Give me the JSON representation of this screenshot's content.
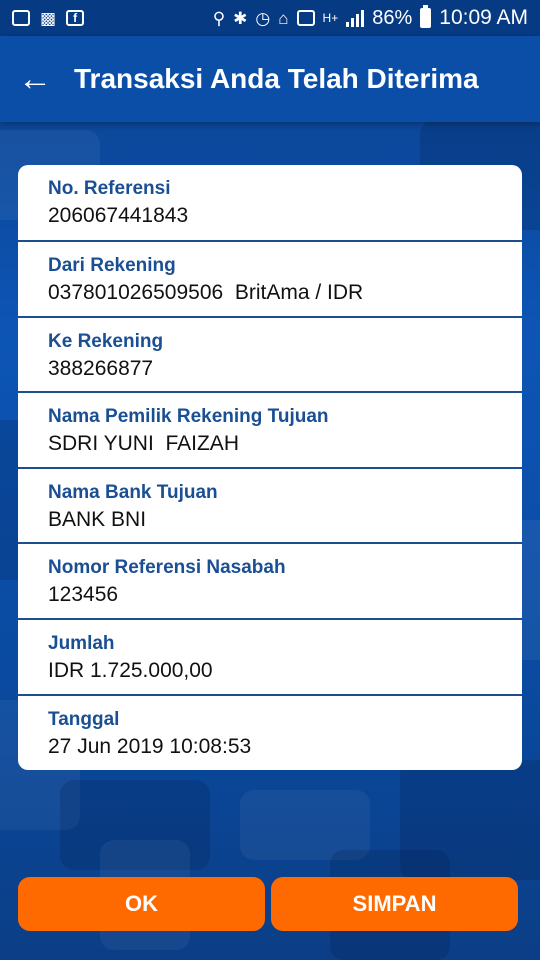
{
  "status_bar": {
    "battery": "86%",
    "time": "10:09 AM",
    "left_icons": [
      "mail-icon",
      "car-icon",
      "facebook-icon"
    ],
    "right_icons": [
      "location-icon",
      "bluetooth-icon",
      "alarm-icon",
      "home-icon",
      "signal-icon",
      "network-icon",
      "signal-bars-icon",
      "battery-icon"
    ]
  },
  "header": {
    "title": "Transaksi Anda Telah Diterima",
    "back_icon": "arrow-left-icon"
  },
  "details": [
    {
      "label": "No. Referensi",
      "value": "206067441843"
    },
    {
      "label": "Dari Rekening",
      "value": "037801026509506  BritAma / IDR"
    },
    {
      "label": "Ke Rekening",
      "value": "388266877"
    },
    {
      "label": "Nama Pemilik Rekening Tujuan",
      "value": "SDRI YUNI  FAIZAH"
    },
    {
      "label": "Nama Bank Tujuan",
      "value": "BANK BNI"
    },
    {
      "label": "Nomor Referensi Nasabah",
      "value": "123456"
    },
    {
      "label": "Jumlah",
      "value": "IDR 1.725.000,00"
    },
    {
      "label": "Tanggal",
      "value": "27 Jun 2019 10:08:53"
    }
  ],
  "actions": {
    "ok_label": "OK",
    "save_label": "SIMPAN"
  },
  "colors": {
    "primary": "#0a4ea8",
    "accent": "#ff6a00",
    "label": "#1b4f94"
  }
}
